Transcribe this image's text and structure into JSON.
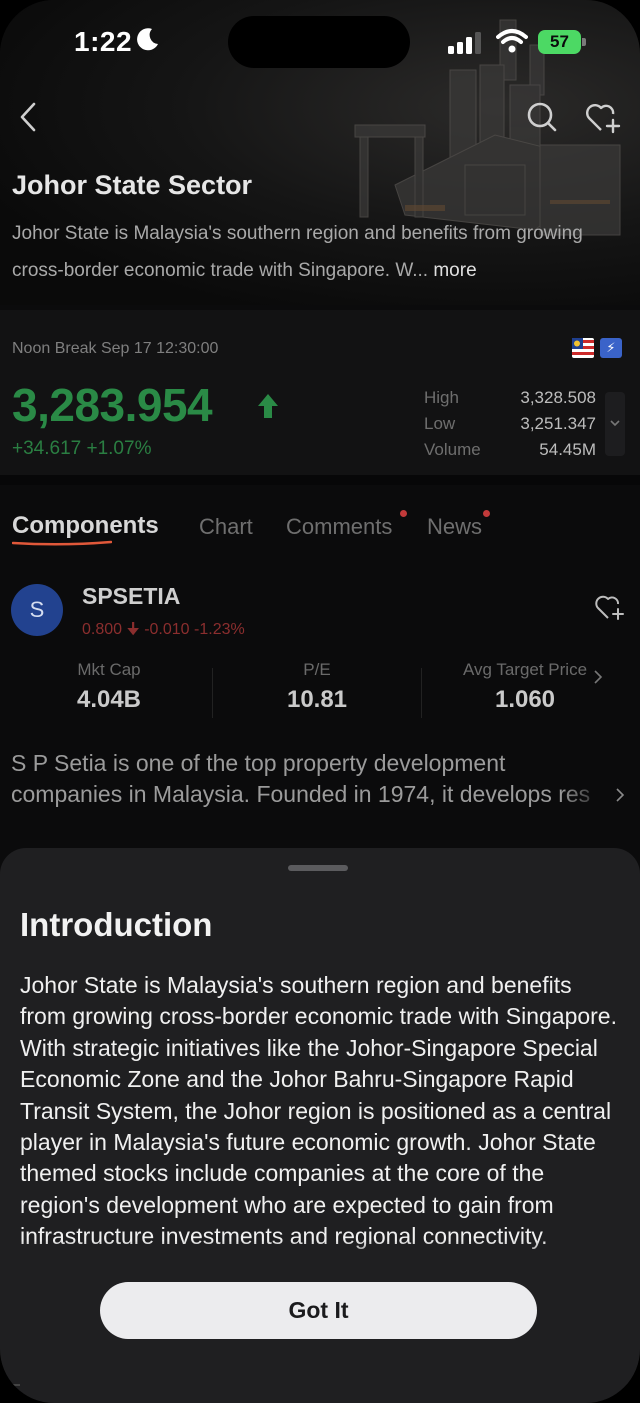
{
  "status_bar": {
    "time": "1:22",
    "battery": "57"
  },
  "header": {
    "title": "Johor State Sector",
    "description": "Johor State is Malaysia's southern region and benefits from growing cross-border economic trade with Singapore. W...",
    "more_label": "more"
  },
  "quote": {
    "session": "Noon Break Sep 17 12:30:00",
    "price": "3,283.954",
    "change": "+34.617 +1.07%",
    "stats": [
      {
        "label": "High",
        "value": "3,328.508"
      },
      {
        "label": "Low",
        "value": "3,251.347"
      },
      {
        "label": "Volume",
        "value": "54.45M"
      }
    ],
    "colors": {
      "up": "#2a8a46"
    }
  },
  "tabs": [
    "Components",
    "Chart",
    "Comments",
    "News"
  ],
  "stock": {
    "avatar_letter": "S",
    "ticker": "SPSETIA",
    "price": "0.800",
    "change": "-0.010 -1.23%",
    "metrics": [
      {
        "label": "Mkt Cap",
        "value": "4.04B"
      },
      {
        "label": "P/E",
        "value": "10.81"
      },
      {
        "label": "Avg Target Price",
        "value": "1.060"
      }
    ],
    "description_line1": "S P Setia is one of the top property development",
    "description_line2": "companies in Malaysia. Founded in 1974, it develops res"
  },
  "sheet": {
    "title": "Introduction",
    "body": "Johor State is Malaysia's southern region and benefits from growing cross-border economic trade with Singapore. With strategic initiatives like the Johor-Singapore Special Economic Zone and the Johor Bahru-Singapore Rapid Transit System, the Johor region is positioned as a central player in Malaysia's future economic growth. Johor State themed stocks include companies at the core of the region's development who are expected to gain from infrastructure investments and regional connectivity.",
    "button_label": "Got It"
  }
}
